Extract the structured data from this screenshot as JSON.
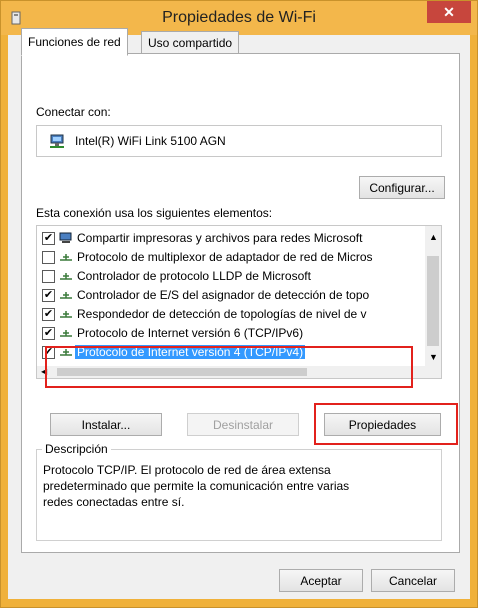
{
  "window": {
    "title": "Propiedades de Wi-Fi",
    "close_label": "✕"
  },
  "tabs": [
    {
      "label": "Funciones de red"
    },
    {
      "label": "Uso compartido"
    }
  ],
  "connect": {
    "label": "Conectar con:",
    "adapter": "Intel(R) WiFi Link 5100 AGN",
    "configure_button": "Configurar..."
  },
  "elements": {
    "label": "Esta conexión usa los siguientes elementos:",
    "items": [
      {
        "checked": true,
        "text": "Compartir impresoras y archivos para redes Microsoft",
        "icon": "network-share-icon"
      },
      {
        "checked": false,
        "text": "Protocolo de multiplexor de adaptador de red de Micros",
        "icon": "protocol-icon"
      },
      {
        "checked": false,
        "text": "Controlador de protocolo LLDP de Microsoft",
        "icon": "protocol-icon"
      },
      {
        "checked": true,
        "text": "Controlador de E/S del asignador de detección de topo",
        "icon": "protocol-icon"
      },
      {
        "checked": true,
        "text": "Respondedor de detección de topologías de nivel de v",
        "icon": "protocol-icon"
      },
      {
        "checked": true,
        "text": "Protocolo de Internet versión 6 (TCP/IPv6)",
        "icon": "protocol-icon"
      },
      {
        "checked": true,
        "text": "Protocolo de Internet versión 4 (TCP/IPv4)",
        "icon": "protocol-icon",
        "selected": true
      }
    ]
  },
  "buttons": {
    "install": "Instalar...",
    "uninstall": "Desinstalar",
    "properties": "Propiedades"
  },
  "description": {
    "title": "Descripción",
    "text": "Protocolo TCP/IP. El protocolo de red de área extensa predeterminado que permite la comunicación entre varias redes conectadas entre sí."
  },
  "footer": {
    "ok": "Aceptar",
    "cancel": "Cancelar"
  },
  "colors": {
    "titlebar": "#f3b74b",
    "close": "#c7463d",
    "selection": "#3399ff",
    "highlight": "#e2211c"
  }
}
